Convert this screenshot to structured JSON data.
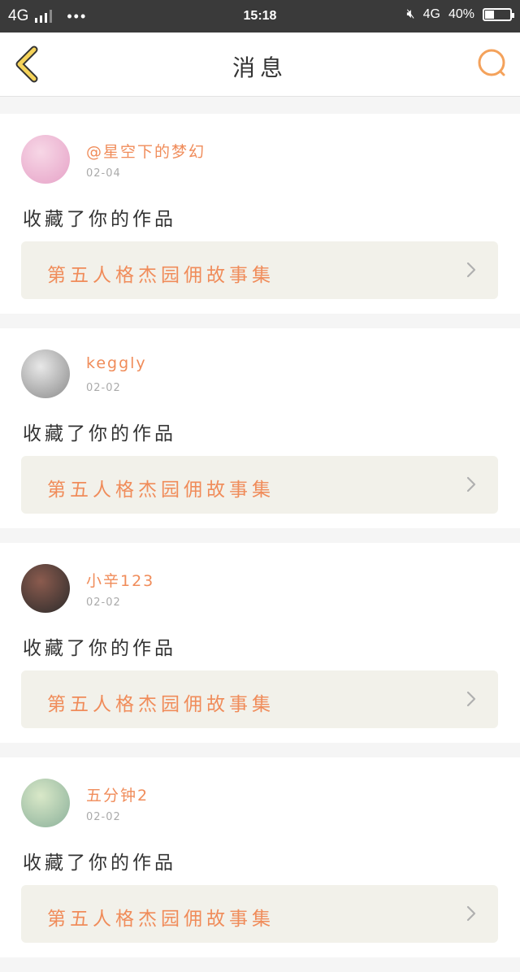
{
  "status_bar": {
    "network": "4G",
    "dots": "•••",
    "time": "15:18",
    "network_right": "4G",
    "battery_text": "40%",
    "battery_level": 0.4
  },
  "header": {
    "title": "消息",
    "back_icon": "chevron-left-icon",
    "search_icon": "search-icon",
    "accent_color": "#f4a25b",
    "back_color": "#f5d35a"
  },
  "notifications": [
    {
      "username": "@星空下的梦幻",
      "date": "02-04",
      "action": "收藏了你的作品",
      "work_title": "第五人格杰园佣故事集",
      "avatar_colors": [
        "#f7d7e6",
        "#e6a2c7"
      ]
    },
    {
      "username": "keggly",
      "date": "02-02",
      "action": "收藏了你的作品",
      "work_title": "第五人格杰园佣故事集",
      "avatar_colors": [
        "#e8e8e8",
        "#8a8a8a"
      ]
    },
    {
      "username": "小辛123",
      "date": "02-02",
      "action": "收藏了你的作品",
      "work_title": "第五人格杰园佣故事集",
      "avatar_colors": [
        "#8b5b4e",
        "#2b2b2b"
      ]
    },
    {
      "username": "五分钟2",
      "date": "02-02",
      "action": "收藏了你的作品",
      "work_title": "第五人格杰园佣故事集",
      "avatar_colors": [
        "#d9e8c8",
        "#8ab09a"
      ]
    }
  ]
}
